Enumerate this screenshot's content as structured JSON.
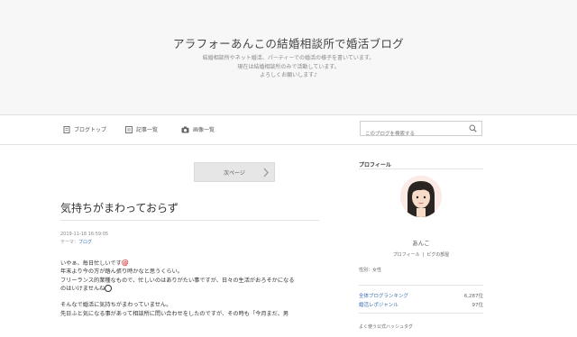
{
  "header": {
    "title": "アラフォーあんこの結婚相談所で婚活ブログ",
    "description": [
      "結婚相談所やネット婚活、パーティーでの婚活の様子を書いています。",
      "現在は結婚相談所のみで活動しています。",
      "よろしくお願いします♪"
    ]
  },
  "nav": {
    "items": [
      {
        "label": "ブログトップ",
        "icon": "book-icon"
      },
      {
        "label": "記事一覧",
        "icon": "list-icon"
      },
      {
        "label": "画像一覧",
        "icon": "camera-icon"
      }
    ],
    "search_placeholder": "このブログを検索する"
  },
  "post": {
    "next_label": "次ページ",
    "title": "気持ちがまわっておらず",
    "date": "2019-11-18 16:59:05",
    "theme_prefix": "テーマ：",
    "theme_link": "ブログ",
    "body": [
      "いやぁ、毎日忙しいです",
      "年末より今の方が踏ん張り時かなと思うくらい。",
      "フリーランス的業種なもので、忙しいのはありがたい事ですが、日々の生活がおろそかになる",
      "のはいけませんね",
      "",
      "そんなで婚活に気持ちがまわっていません。",
      "先日ふと気になる事があって相談所に問い合わせをしたのですが、その時も「今月まだ、男"
    ]
  },
  "sidebar": {
    "heading": "プロフィール",
    "name": "あんこ",
    "links": [
      "プロフィール",
      "ピグの部屋"
    ],
    "gender": "性別：女性",
    "rankings": [
      {
        "label": "全体ブログランキング",
        "value": "6,287位"
      },
      {
        "label": "婚活レポジャンル",
        "value": "97位"
      }
    ],
    "hashtags_heading": "よく使う公式ハッシュタグ"
  },
  "colors": {
    "link": "#3a6fb5",
    "header_bg": "#f7f7f7",
    "emoji_red": "#e23a3a"
  }
}
